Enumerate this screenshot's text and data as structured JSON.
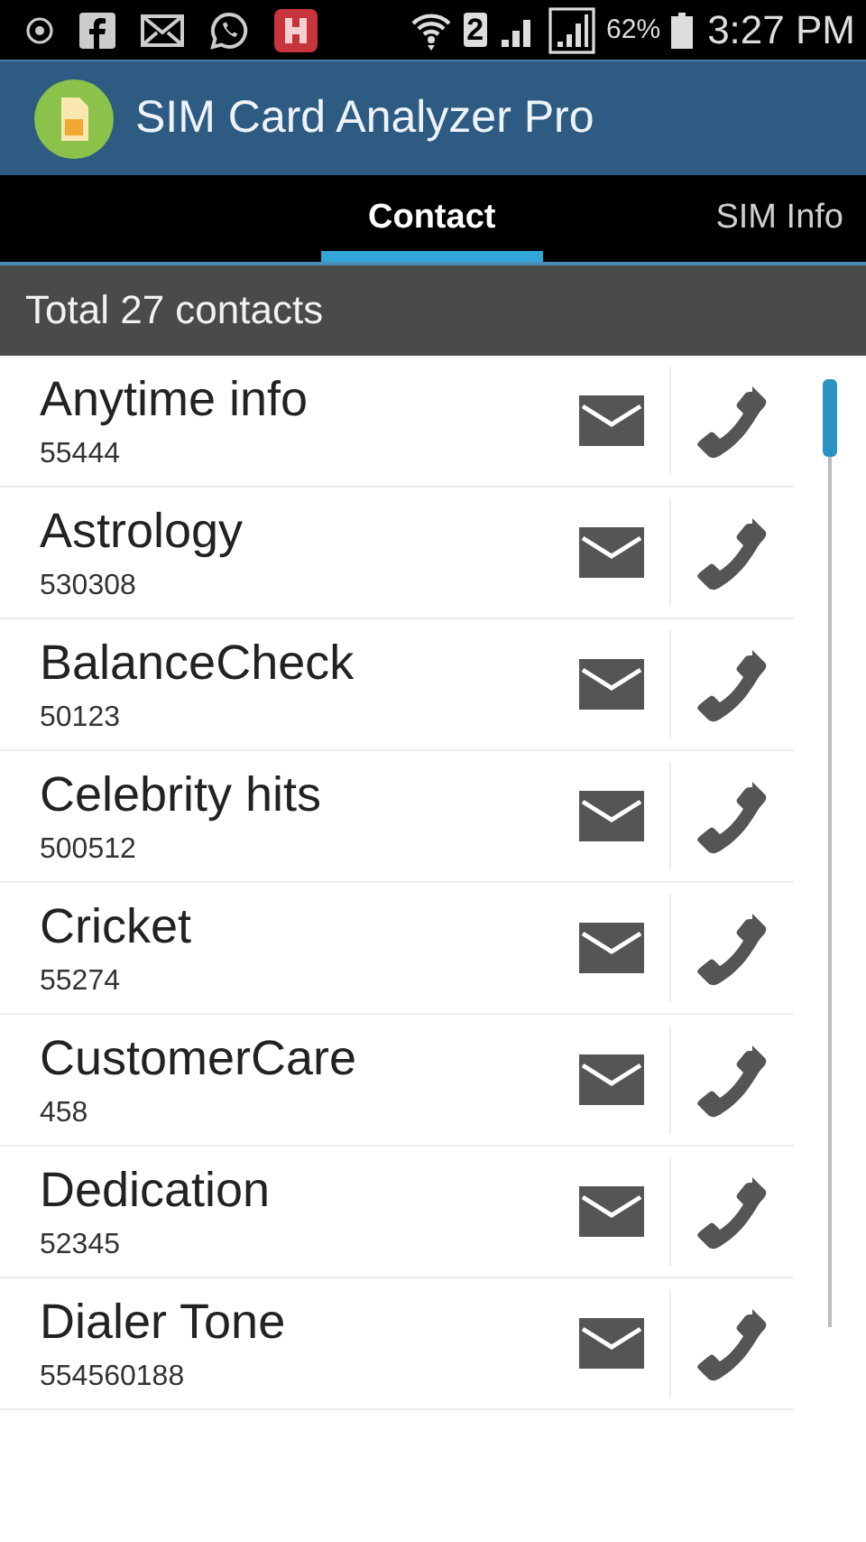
{
  "status_bar": {
    "sim_slot": "2",
    "battery": "62%",
    "time": "3:27 PM"
  },
  "app_bar": {
    "title": "SIM Card Analyzer Pro"
  },
  "tabs": [
    {
      "label": "Contact",
      "selected": true
    },
    {
      "label": "SIM Info",
      "selected": false
    }
  ],
  "header": "Total 27 contacts",
  "contacts": [
    {
      "name": "Anytime info",
      "number": "55444"
    },
    {
      "name": "Astrology",
      "number": "530308"
    },
    {
      "name": "BalanceCheck",
      "number": "50123"
    },
    {
      "name": "Celebrity hits",
      "number": "500512"
    },
    {
      "name": "Cricket",
      "number": "55274"
    },
    {
      "name": "CustomerCare",
      "number": "458"
    },
    {
      "name": "Dedication",
      "number": "52345"
    },
    {
      "name": "Dialer Tone",
      "number": "554560188"
    }
  ]
}
